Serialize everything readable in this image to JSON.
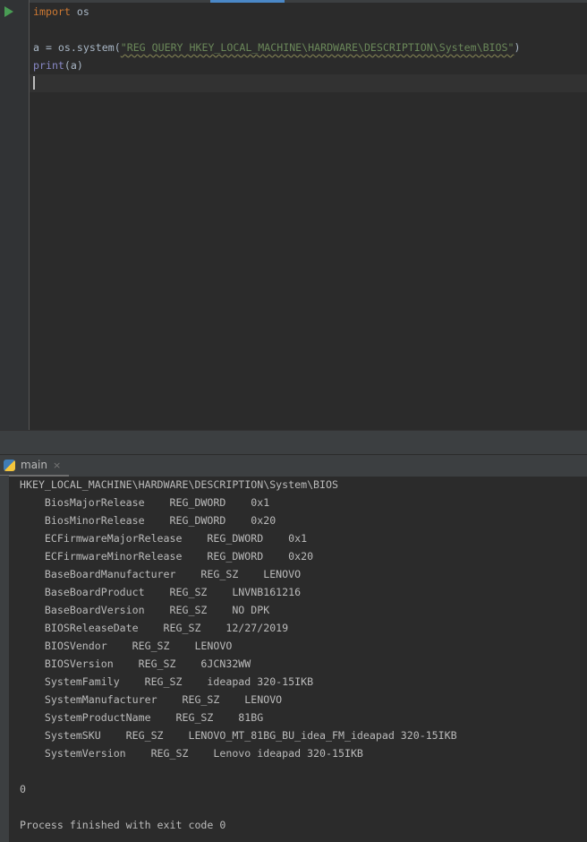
{
  "editor": {
    "lines": [
      {
        "kw": "import",
        "rest": " os"
      },
      {
        "pre": "a = os.system(",
        "str": "\"REG QUERY HKEY_LOCAL_MACHINE\\HARDWARE\\DESCRIPTION\\System\\BIOS\"",
        "post": ")"
      },
      {
        "fn": "print",
        "rest": "(a)"
      }
    ]
  },
  "run_panel": {
    "tab_label": "main",
    "close": "×"
  },
  "console": {
    "lines": [
      "HKEY_LOCAL_MACHINE\\HARDWARE\\DESCRIPTION\\System\\BIOS",
      "    BiosMajorRelease    REG_DWORD    0x1",
      "    BiosMinorRelease    REG_DWORD    0x20",
      "    ECFirmwareMajorRelease    REG_DWORD    0x1",
      "    ECFirmwareMinorRelease    REG_DWORD    0x20",
      "    BaseBoardManufacturer    REG_SZ    LENOVO",
      "    BaseBoardProduct    REG_SZ    LNVNB161216",
      "    BaseBoardVersion    REG_SZ    NO DPK",
      "    BIOSReleaseDate    REG_SZ    12/27/2019",
      "    BIOSVendor    REG_SZ    LENOVO",
      "    BIOSVersion    REG_SZ    6JCN32WW",
      "    SystemFamily    REG_SZ    ideapad 320-15IKB",
      "    SystemManufacturer    REG_SZ    LENOVO",
      "    SystemProductName    REG_SZ    81BG",
      "    SystemSKU    REG_SZ    LENOVO_MT_81BG_BU_idea_FM_ideapad 320-15IKB",
      "    SystemVersion    REG_SZ    Lenovo ideapad 320-15IKB",
      "",
      "0",
      "",
      "Process finished with exit code 0"
    ]
  }
}
